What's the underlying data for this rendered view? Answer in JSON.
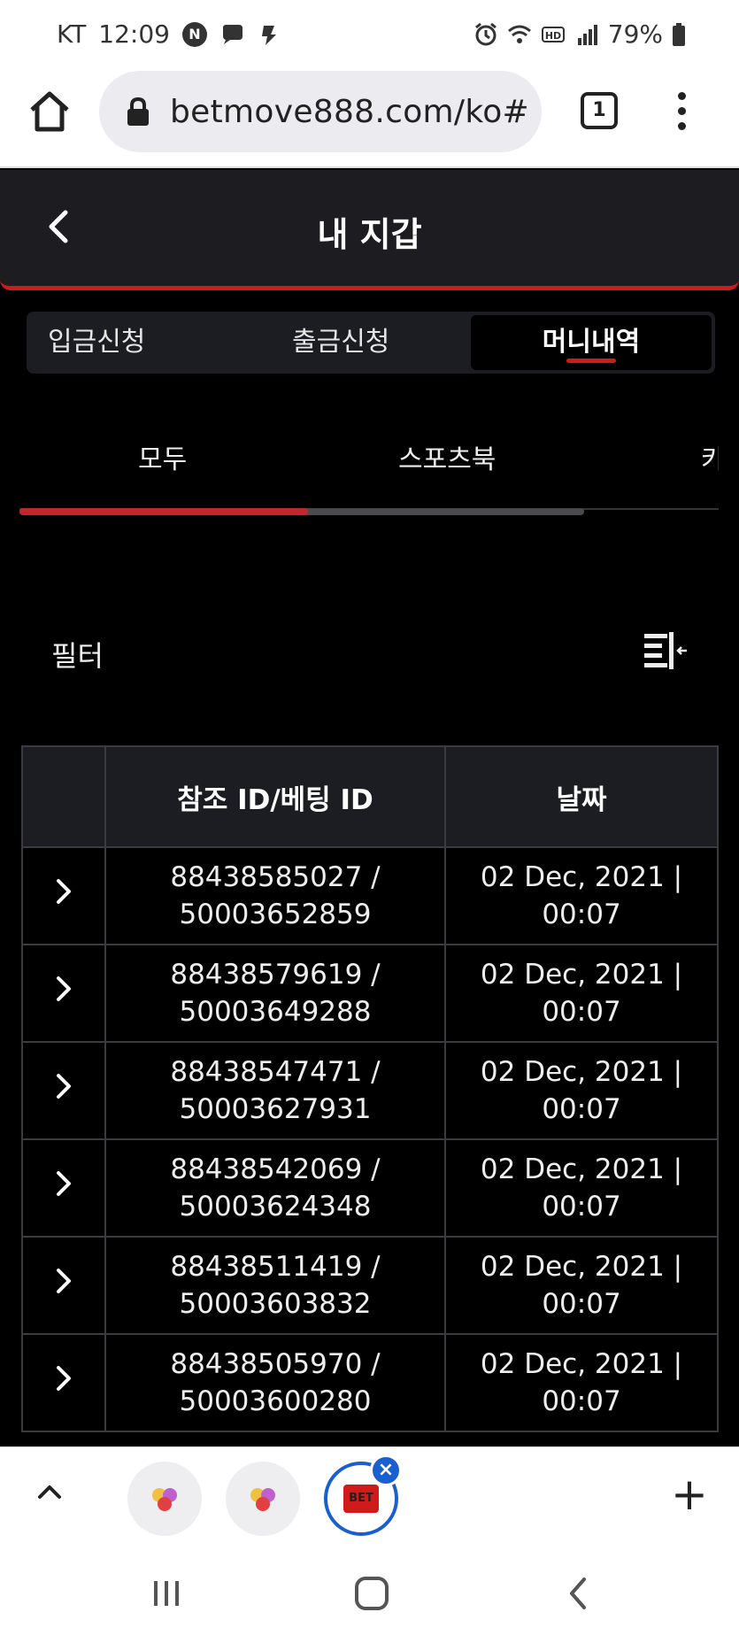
{
  "status_bar": {
    "carrier": "KT",
    "time": "12:09",
    "battery": "79%"
  },
  "browser": {
    "url": "betmove888.com/ko#",
    "tab_count": "1"
  },
  "header": {
    "title": "내 지갑"
  },
  "wallet_tabs": [
    {
      "label": "입금신청"
    },
    {
      "label": "출금신청"
    },
    {
      "label": "머니내역",
      "active": true
    }
  ],
  "category_tabs": [
    {
      "label": "모두",
      "active": true
    },
    {
      "label": "스포츠북"
    },
    {
      "label": "카"
    }
  ],
  "filter": {
    "label": "필터"
  },
  "table": {
    "headers": [
      "",
      "참조 ID/베팅 ID",
      "날짜"
    ],
    "rows": [
      {
        "ref": "88438585027 /",
        "bet": "50003652859",
        "date": "02 Dec, 2021 |",
        "time": "00:07"
      },
      {
        "ref": "88438579619 /",
        "bet": "50003649288",
        "date": "02 Dec, 2021 |",
        "time": "00:07"
      },
      {
        "ref": "88438547471 /",
        "bet": "50003627931",
        "date": "02 Dec, 2021 |",
        "time": "00:07"
      },
      {
        "ref": "88438542069 /",
        "bet": "50003624348",
        "date": "02 Dec, 2021 |",
        "time": "00:07"
      },
      {
        "ref": "88438511419 /",
        "bet": "50003603832",
        "date": "02 Dec, 2021 |",
        "time": "00:07"
      },
      {
        "ref": "88438505970 /",
        "bet": "50003600280",
        "date": "02 Dec, 2021 |",
        "time": "00:07"
      }
    ]
  },
  "tab_strip": {
    "active_tab_logo": "BET"
  },
  "colors": {
    "accent_red": "#d11a1a",
    "header_bg": "#1c1c21",
    "active_tab_ring": "#1a5fd0"
  }
}
